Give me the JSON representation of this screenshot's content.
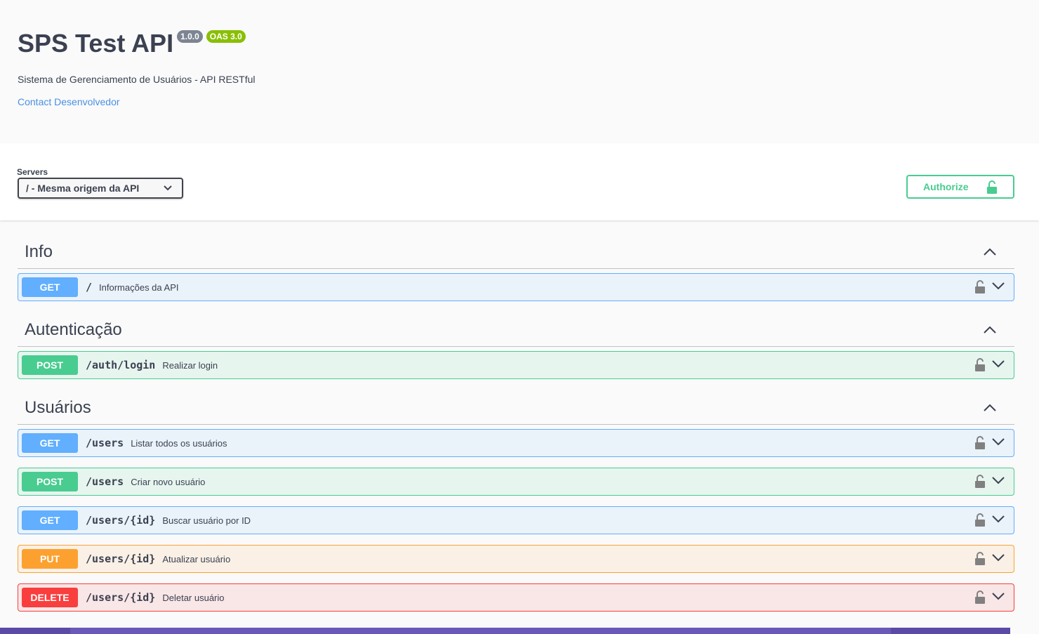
{
  "info": {
    "title": "SPS Test API",
    "version": "1.0.0",
    "oas_badge": "OAS 3.0",
    "description": "Sistema de Gerenciamento de Usuários - API RESTful",
    "contact_link": "Contact Desenvolvedor"
  },
  "servers": {
    "label": "Servers",
    "selected": "/ - Mesma origem da API"
  },
  "authorize": {
    "label": "Authorize"
  },
  "sections": [
    {
      "title": "Info",
      "operations": [
        {
          "method": "GET",
          "path": "/",
          "summary": "Informações da API"
        }
      ]
    },
    {
      "title": "Autenticação",
      "operations": [
        {
          "method": "POST",
          "path": "/auth/login",
          "summary": "Realizar login"
        }
      ]
    },
    {
      "title": "Usuários",
      "operations": [
        {
          "method": "GET",
          "path": "/users",
          "summary": "Listar todos os usuários"
        },
        {
          "method": "POST",
          "path": "/users",
          "summary": "Criar novo usuário"
        },
        {
          "method": "GET",
          "path": "/users/{id}",
          "summary": "Buscar usuário por ID"
        },
        {
          "method": "PUT",
          "path": "/users/{id}",
          "summary": "Atualizar usuário"
        },
        {
          "method": "DELETE",
          "path": "/users/{id}",
          "summary": "Deletar usuário"
        }
      ]
    }
  ],
  "colors": {
    "get": "#61affe",
    "post": "#49cc90",
    "put": "#fca130",
    "delete": "#f93e3e",
    "link": "#4990e2"
  },
  "icons": {
    "authorize": "unlock-icon",
    "operation_lock": "unlock-icon",
    "section_toggle": "chevron-up-icon",
    "operation_toggle": "chevron-down-icon",
    "server_select": "chevron-down-icon"
  }
}
